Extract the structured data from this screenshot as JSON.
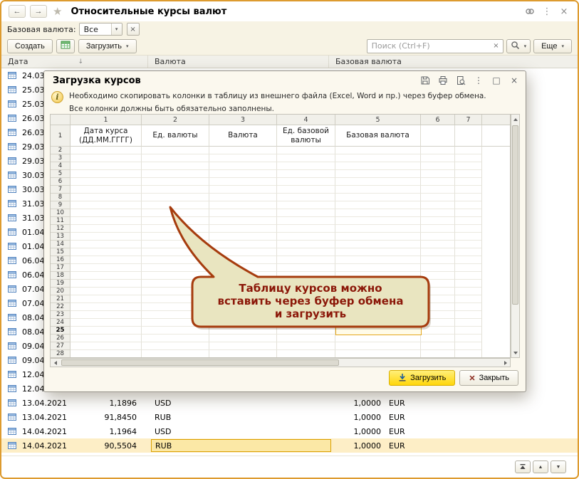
{
  "colors": {
    "frame_border": "#dd9b2f",
    "selection_border": "#dba000",
    "selection_bg": "#fdeec6",
    "callout_border": "#a63c0e",
    "callout_fill": "#e9e5c0",
    "callout_text": "#8b1708",
    "load_button_bg": "#ffd60a"
  },
  "icons": {
    "back": "←",
    "forward": "→",
    "star": "★",
    "kebab": "⋮",
    "close": "×",
    "caret": "▾",
    "sort_down": "↓",
    "clear": "×",
    "maximize": "□",
    "close_x": "✕",
    "info": "i",
    "up": "▲",
    "down": "▼"
  },
  "window": {
    "title": "Относительные курсы валют"
  },
  "filter_bar": {
    "label": "Базовая валюта:",
    "value": "Все"
  },
  "command_bar": {
    "create": "Создать",
    "load": "Загрузить",
    "more": "Еще",
    "search_placeholder": "Поиск (Ctrl+F)"
  },
  "list": {
    "headers": {
      "date": "Дата",
      "currency": "Валюта",
      "base": "Базовая валюта"
    },
    "clipped_rows": [
      "24.03",
      "25.03",
      "25.03",
      "26.03",
      "26.03",
      "29.03",
      "29.03",
      "30.03",
      "30.03",
      "31.03",
      "31.03",
      "01.04",
      "01.04",
      "06.04",
      "06.04",
      "07.04",
      "07.04",
      "08.04",
      "08.04",
      "09.04",
      "09.04",
      "12.04",
      "12.04"
    ],
    "bottom_rows": [
      {
        "date": "13.04.2021",
        "rate": "1,1896",
        "code": "USD",
        "base_rate": "1,0000",
        "base_code": "EUR"
      },
      {
        "date": "13.04.2021",
        "rate": "91,8450",
        "code": "RUB",
        "base_rate": "1,0000",
        "base_code": "EUR"
      },
      {
        "date": "14.04.2021",
        "rate": "1,1964",
        "code": "USD",
        "base_rate": "1,0000",
        "base_code": "EUR"
      },
      {
        "date": "14.04.2021",
        "rate": "90,5504",
        "code": "RUB",
        "base_rate": "1,0000",
        "base_code": "EUR"
      }
    ]
  },
  "dialog": {
    "title": "Загрузка курсов",
    "info_line1": "Необходимо скопировать колонки в таблицу из внешнего файла (Excel, Word и пр.) через буфер обмена.",
    "info_line2": "Все колонки должны быть обязательно заполнены.",
    "grid": {
      "col_numbers": [
        "1",
        "2",
        "3",
        "4",
        "5",
        "6",
        "7"
      ],
      "first_row_number": "1",
      "header_cells": [
        "Дата курса (ДД.ММ.ГГГГ)",
        "Ед. валюты",
        "Валюта",
        "Ед. базовой валюты",
        "Базовая валюта"
      ],
      "row_numbers": [
        "2",
        "3",
        "4",
        "5",
        "6",
        "7",
        "8",
        "9",
        "10",
        "11",
        "12",
        "13",
        "14",
        "15",
        "16",
        "17",
        "18",
        "19",
        "20",
        "21",
        "22",
        "23",
        "24",
        "25",
        "26",
        "27",
        "28"
      ]
    },
    "callout": {
      "line1": "Таблицу курсов можно",
      "line2": "вставить через буфер обмена",
      "line3": "и загрузить"
    },
    "buttons": {
      "load": "Загрузить",
      "close": "Закрыть"
    }
  }
}
